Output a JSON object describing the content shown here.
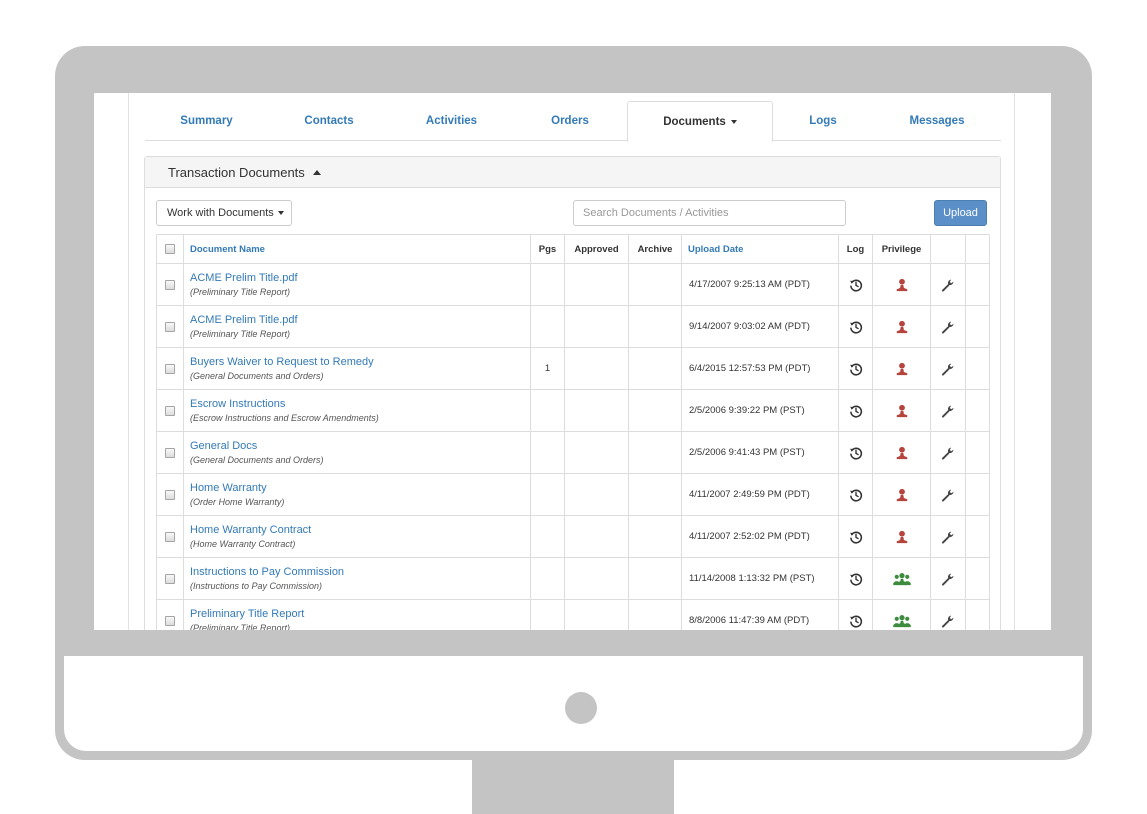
{
  "tabs": [
    {
      "label": "Summary"
    },
    {
      "label": "Contacts"
    },
    {
      "label": "Activities"
    },
    {
      "label": "Orders"
    },
    {
      "label": "Documents"
    },
    {
      "label": "Logs"
    },
    {
      "label": "Messages"
    }
  ],
  "active_tab": "Documents",
  "panel": {
    "title": "Transaction Documents"
  },
  "toolbar": {
    "work_label": "Work with Documents",
    "search_placeholder": "Search Documents / Activities",
    "upload_label": "Upload"
  },
  "table": {
    "headers": {
      "name": "Document Name",
      "pgs": "Pgs",
      "approved": "Approved",
      "archive": "Archive",
      "date": "Upload Date",
      "log": "Log",
      "privilege": "Privilege"
    },
    "rows": [
      {
        "name": "ACME Prelim Title.pdf",
        "type": "(Preliminary Title Report)",
        "pgs": "",
        "approved": "",
        "archive": "",
        "date": "4/17/2007 9:25:13 AM (PDT)",
        "privilege": "single-user-icon"
      },
      {
        "name": "ACME Prelim Title.pdf",
        "type": "(Preliminary Title Report)",
        "pgs": "",
        "approved": "",
        "archive": "",
        "date": "9/14/2007 9:03:02 AM (PDT)",
        "privilege": "single-user-icon"
      },
      {
        "name": "Buyers Waiver to Request to Remedy",
        "type": "(General Documents and Orders)",
        "pgs": "1",
        "approved": "",
        "archive": "",
        "date": "6/4/2015 12:57:53 PM (PDT)",
        "privilege": "single-user-icon"
      },
      {
        "name": "Escrow Instructions",
        "type": "(Escrow Instructions and Escrow Amendments)",
        "pgs": "",
        "approved": "",
        "archive": "",
        "date": "2/5/2006 9:39:22 PM (PST)",
        "privilege": "single-user-icon"
      },
      {
        "name": "General Docs",
        "type": "(General Documents and Orders)",
        "pgs": "",
        "approved": "",
        "archive": "",
        "date": "2/5/2006 9:41:43 PM (PST)",
        "privilege": "single-user-icon"
      },
      {
        "name": "Home Warranty",
        "type": "(Order Home Warranty)",
        "pgs": "",
        "approved": "",
        "archive": "",
        "date": "4/11/2007 2:49:59 PM (PDT)",
        "privilege": "single-user-icon"
      },
      {
        "name": "Home Warranty Contract",
        "type": "(Home Warranty Contract)",
        "pgs": "",
        "approved": "",
        "archive": "",
        "date": "4/11/2007 2:52:02 PM (PDT)",
        "privilege": "single-user-icon"
      },
      {
        "name": "Instructions to Pay Commission",
        "type": "(Instructions to Pay Commission)",
        "pgs": "",
        "approved": "",
        "archive": "",
        "date": "11/14/2008 1:13:32 PM (PST)",
        "privilege": "group-users-icon"
      },
      {
        "name": "Preliminary Title Report",
        "type": "(Preliminary Title Report)",
        "pgs": "",
        "approved": "",
        "archive": "",
        "date": "8/8/2006 11:47:39 AM (PDT)",
        "privilege": "group-users-icon"
      }
    ]
  },
  "colors": {
    "link": "#337ab7",
    "upload_button": "#5b8fc8",
    "single_user": "#b5443d",
    "group_users": "#3d8b3d",
    "frame": "#c4c4c4"
  },
  "icons": {
    "log": "history-icon",
    "settings": "wrench-icon"
  }
}
